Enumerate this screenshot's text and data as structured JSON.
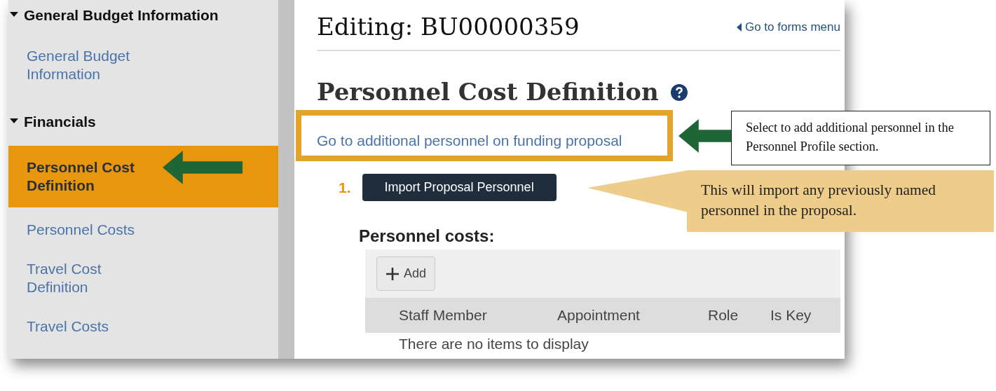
{
  "sidebar": {
    "sections": [
      {
        "title": "General Budget Information",
        "expanded": true,
        "items": [
          {
            "label": "General Budget Information",
            "selected": false
          }
        ]
      },
      {
        "title": "Financials",
        "expanded": true,
        "items": [
          {
            "label": "Personnel Cost Definition",
            "selected": true
          },
          {
            "label": "Personnel Costs",
            "selected": false
          },
          {
            "label": "Travel Cost Definition",
            "selected": false
          },
          {
            "label": "Travel Costs",
            "selected": false
          }
        ]
      }
    ]
  },
  "header": {
    "title": "Editing: BU00000359",
    "back_link": "Go to forms menu"
  },
  "page_title": "Personnel Cost Definition",
  "proposal_link": "Go to additional personnel on funding proposal",
  "steps": [
    {
      "number": "1.",
      "button": "Import Proposal Personnel"
    }
  ],
  "personnel_costs": {
    "heading": "Personnel costs:",
    "add_button": "Add",
    "columns": [
      "Staff Member",
      "Appointment",
      "Role",
      "Is Key"
    ],
    "empty_message": "There are no items to display"
  },
  "annotations": [
    {
      "kind": "boxed",
      "text": "Select to add additional personnel in the Personnel Profile section."
    },
    {
      "kind": "speech",
      "text": "This will import any previously named personnel in the proposal."
    }
  ]
}
